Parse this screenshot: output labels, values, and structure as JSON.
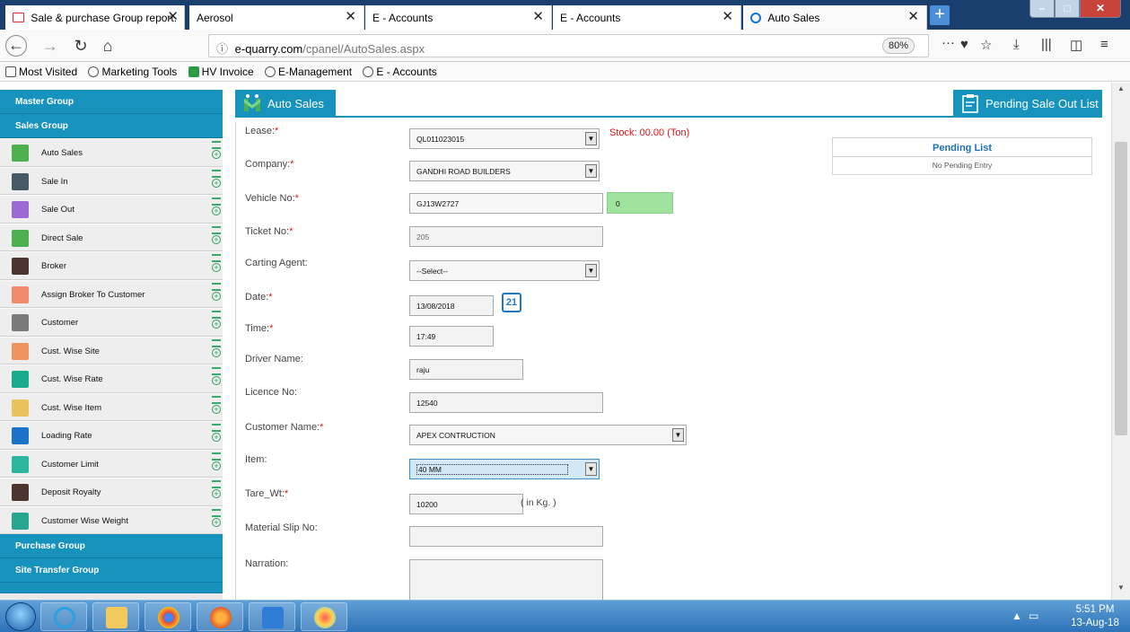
{
  "browser": {
    "tabs": [
      {
        "label": "Sale & purchase Group report.",
        "icon": "gmail-icon"
      },
      {
        "label": "Aerosol",
        "icon": ""
      },
      {
        "label": "E - Accounts",
        "icon": ""
      },
      {
        "label": "E - Accounts",
        "icon": ""
      },
      {
        "label": "Auto Sales",
        "icon": "site-icon"
      }
    ],
    "url_host": "e-quarry.com",
    "url_path": "/cpanel/AutoSales.aspx",
    "zoom": "80%",
    "bookmarks": [
      "Most Visited",
      "Marketing Tools",
      "HV Invoice",
      "E-Management",
      "E - Accounts"
    ]
  },
  "sidebar": {
    "groups": {
      "master": "Master Group",
      "sales": "Sales Group",
      "purchase": "Purchase Group",
      "site_transfer": "Site Transfer Group"
    },
    "items": [
      {
        "label": "Auto Sales",
        "icon": "truck-icon",
        "color": "#4caf50"
      },
      {
        "label": "Sale In",
        "icon": "user-icon",
        "color": "#455a64"
      },
      {
        "label": "Sale Out",
        "icon": "users-icon",
        "color": "#9c6ad6"
      },
      {
        "label": "Direct Sale",
        "icon": "truck-icon",
        "color": "#4caf50"
      },
      {
        "label": "Broker",
        "icon": "person-icon",
        "color": "#4e342e"
      },
      {
        "label": "Assign Broker To Customer",
        "icon": "document-icon",
        "color": "#f28b6b"
      },
      {
        "label": "Customer",
        "icon": "customer-icon",
        "color": "#7a7a7a"
      },
      {
        "label": "Cust. Wise Site",
        "icon": "site-icon",
        "color": "#f0925e"
      },
      {
        "label": "Cust. Wise Rate",
        "icon": "rate-icon",
        "color": "#19a98d"
      },
      {
        "label": "Cust. Wise Item",
        "icon": "item-icon",
        "color": "#e9c25c"
      },
      {
        "label": "Loading Rate",
        "icon": "rate-icon",
        "color": "#1a73c9"
      },
      {
        "label": "Customer Limit",
        "icon": "limit-icon",
        "color": "#2cb6a0"
      },
      {
        "label": "Deposit Royalty",
        "icon": "royalty-icon",
        "color": "#4e342e"
      },
      {
        "label": "Customer Wise Weight",
        "icon": "scale-icon",
        "color": "#26a58f"
      }
    ]
  },
  "main": {
    "title": "Auto Sales",
    "pending_button": "Pending Sale Out List",
    "stock": "Stock: 00.00 (Ton)",
    "pending_list": {
      "title": "Pending List",
      "empty": "No Pending Entry"
    },
    "fields": {
      "lease": {
        "label": "Lease:",
        "value": "QL011023015"
      },
      "company": {
        "label": "Company:",
        "value": "GANDHI ROAD BUILDERS"
      },
      "vehicle": {
        "label": "Vehicle No:",
        "value": "GJ13W2727",
        "count": "0"
      },
      "ticket": {
        "label": "Ticket No:",
        "value": "205"
      },
      "carting": {
        "label": "Carting Agent:",
        "value": "--Select--"
      },
      "date": {
        "label": "Date:",
        "value": "13/08/2018",
        "cal": "21"
      },
      "time": {
        "label": "Time:",
        "value": "17:49"
      },
      "driver": {
        "label": "Driver Name:",
        "value": "raju"
      },
      "licence": {
        "label": "Licence No:",
        "value": "12540"
      },
      "customer": {
        "label": "Customer Name:",
        "value": "APEX CONTRUCTION"
      },
      "item": {
        "label": "Item:",
        "value": "40 MM"
      },
      "tare": {
        "label": "Tare_Wt:",
        "value": "10200",
        "unit": "( in Kg. )"
      },
      "slip": {
        "label": "Material Slip No:",
        "value": ""
      },
      "narration": {
        "label": "Narration:",
        "value": ""
      }
    },
    "required_mark": "*"
  },
  "taskbar": {
    "time": "5:51 PM",
    "date": "13-Aug-18"
  },
  "colors": {
    "accent": "#1692bd",
    "tab_bar": "#1a3f6e",
    "stock": "#e01010",
    "vehicle_count_bg": "#9fe39f"
  }
}
